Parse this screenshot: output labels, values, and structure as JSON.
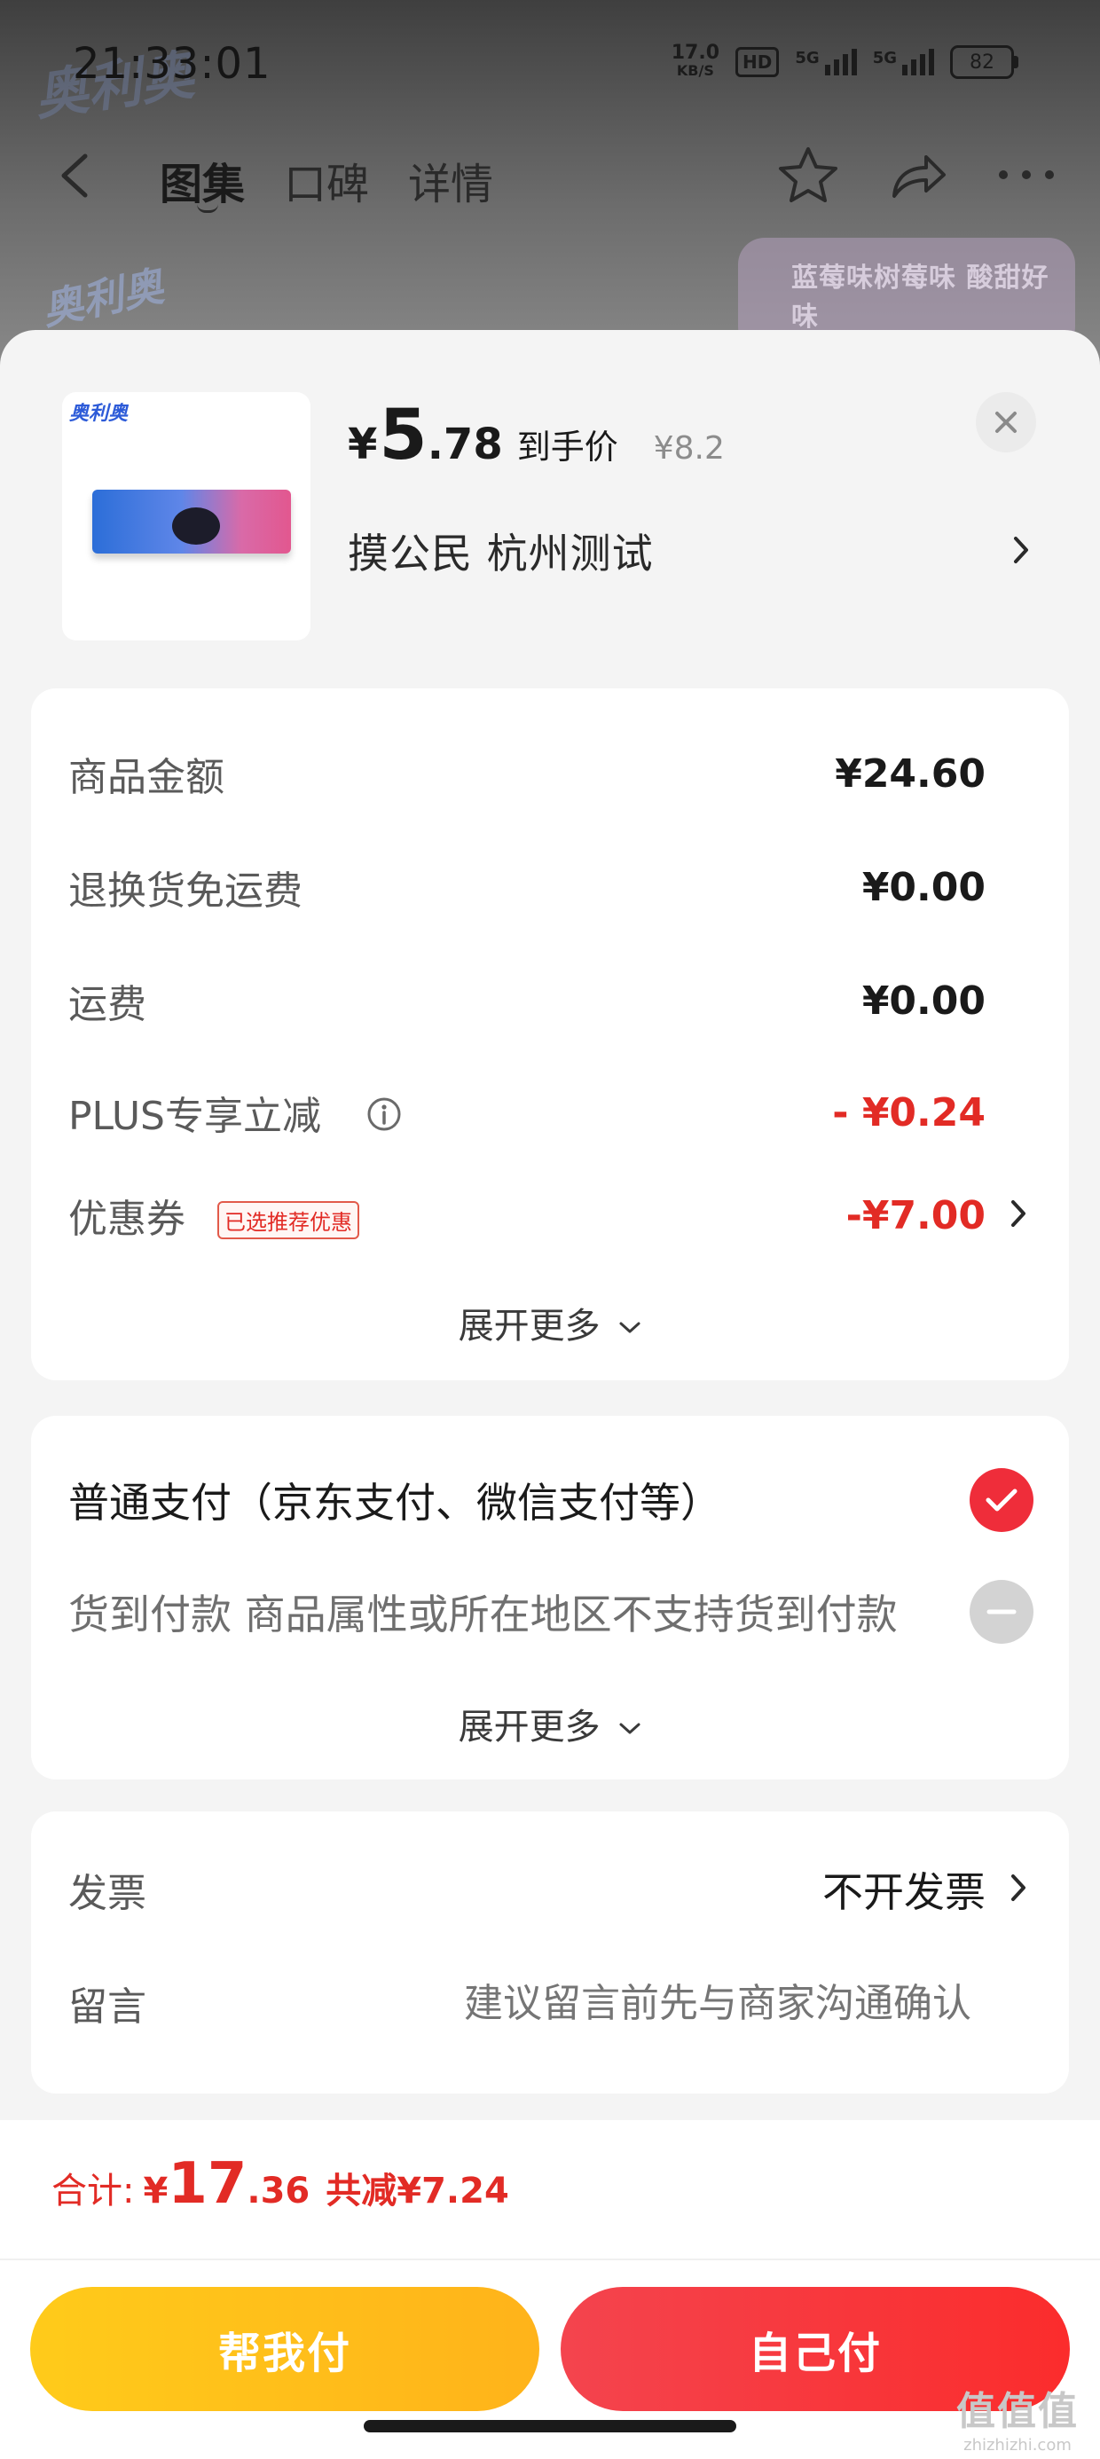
{
  "status_bar": {
    "time": "21:33:01",
    "net_speed": "17.0",
    "net_unit": "KB/S",
    "hd_badge": "HD",
    "signal1_label": "5G",
    "signal2_label": "5G",
    "battery": "82"
  },
  "background": {
    "watermark": "奥利奥",
    "logo": "奥利奥",
    "tabs": [
      {
        "label": "图集",
        "active": true
      },
      {
        "label": "口碑",
        "active": false
      },
      {
        "label": "详情",
        "active": false
      }
    ],
    "banner_text": "蓝莓味树莓味 酸甜好味"
  },
  "product": {
    "thumb_logo": "奥利奥",
    "price_yen": "¥",
    "price_int": "5",
    "price_dec": ".78",
    "price_label": "到手价",
    "original_price": "¥8.2",
    "address": "摸公民  杭州测试"
  },
  "cost": {
    "rows": [
      {
        "label": "商品金额",
        "value": "¥24.60"
      },
      {
        "label": "退换货免运费",
        "value": "¥0.00"
      },
      {
        "label": "运费",
        "value": "¥0.00"
      },
      {
        "label": "PLUS专享立减",
        "value": "- ¥0.24"
      },
      {
        "label": "优惠券",
        "value": "-¥7.00",
        "tag": "已选推荐优惠"
      }
    ],
    "expand_label": "展开更多"
  },
  "payment": {
    "options": [
      {
        "label": "普通支付（京东支付、微信支付等）",
        "selected": true
      },
      {
        "label": "货到付款 商品属性或所在地区不支持货到付款",
        "selected": false
      }
    ],
    "expand_label": "展开更多"
  },
  "extra": {
    "invoice_label": "发票",
    "invoice_value": "不开发票",
    "message_label": "留言",
    "message_placeholder": "建议留言前先与商家沟通确认"
  },
  "footer": {
    "total_label": "合计:",
    "total_yen": "¥",
    "total_int": "17",
    "total_dec": ".36",
    "total_discount": "共减¥7.24",
    "help_pay_label": "帮我付",
    "self_pay_label": "自己付"
  },
  "watermark": {
    "big": "值值值",
    "small": "zhizhizhi.com"
  },
  "colors": {
    "accent_red": "#e22b25",
    "check_red": "#ef2d3a",
    "help_yellow": "#ffbb1a",
    "pay_red": "#f83838"
  }
}
